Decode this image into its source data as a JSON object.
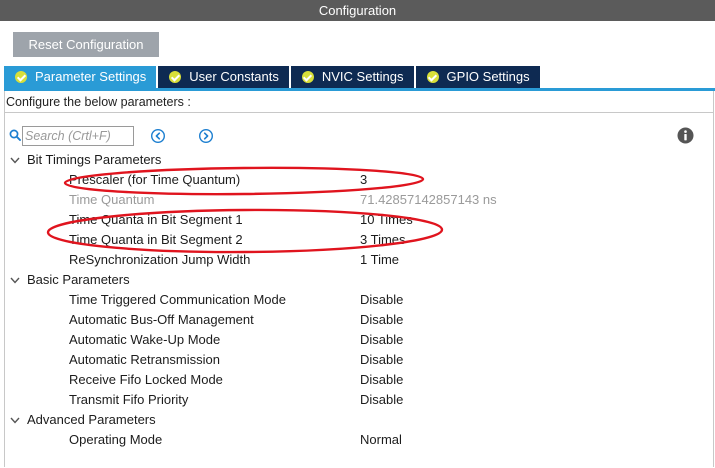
{
  "window": {
    "title": "Configuration"
  },
  "toolbar": {
    "reset_label": "Reset Configuration"
  },
  "tabs": [
    {
      "label": "Parameter Settings",
      "active": true
    },
    {
      "label": "User Constants",
      "active": false
    },
    {
      "label": "NVIC Settings",
      "active": false
    },
    {
      "label": "GPIO Settings",
      "active": false
    }
  ],
  "description": "Configure the below parameters :",
  "search": {
    "placeholder": "Search (Crtl+F)",
    "value": ""
  },
  "colors": {
    "title_bar": "#5b5b5b",
    "tab_active": "#2a9bd6",
    "tab_inactive": "#0e2a52",
    "tab_check": "#d8df3a",
    "annotation": "#e0141e"
  },
  "icons": {
    "search": "search-icon",
    "prev": "arrow-left-circle-icon",
    "next": "arrow-right-circle-icon",
    "info": "info-icon",
    "expand": "chevron-down-icon",
    "tab_check": "check-circle-icon"
  },
  "groups": [
    {
      "label": "Bit Timings Parameters",
      "expanded": true,
      "params": [
        {
          "name": "Prescaler (for Time Quantum)",
          "value": "3",
          "enabled": true
        },
        {
          "name": "Time Quantum",
          "value": "71.42857142857143 ns",
          "enabled": false
        },
        {
          "name": "Time Quanta in Bit Segment 1",
          "value": "10 Times",
          "enabled": true
        },
        {
          "name": "Time Quanta in Bit Segment 2",
          "value": "3 Times",
          "enabled": true
        },
        {
          "name": "ReSynchronization Jump Width",
          "value": "1 Time",
          "enabled": true
        }
      ]
    },
    {
      "label": "Basic Parameters",
      "expanded": true,
      "params": [
        {
          "name": "Time Triggered Communication Mode",
          "value": "Disable",
          "enabled": true
        },
        {
          "name": "Automatic Bus-Off Management",
          "value": "Disable",
          "enabled": true
        },
        {
          "name": "Automatic Wake-Up Mode",
          "value": "Disable",
          "enabled": true
        },
        {
          "name": "Automatic Retransmission",
          "value": "Disable",
          "enabled": true
        },
        {
          "name": "Receive Fifo Locked Mode",
          "value": "Disable",
          "enabled": true
        },
        {
          "name": "Transmit Fifo Priority",
          "value": "Disable",
          "enabled": true
        }
      ]
    },
    {
      "label": "Advanced Parameters",
      "expanded": true,
      "params": [
        {
          "name": "Operating Mode",
          "value": "Normal",
          "enabled": true
        }
      ]
    }
  ]
}
